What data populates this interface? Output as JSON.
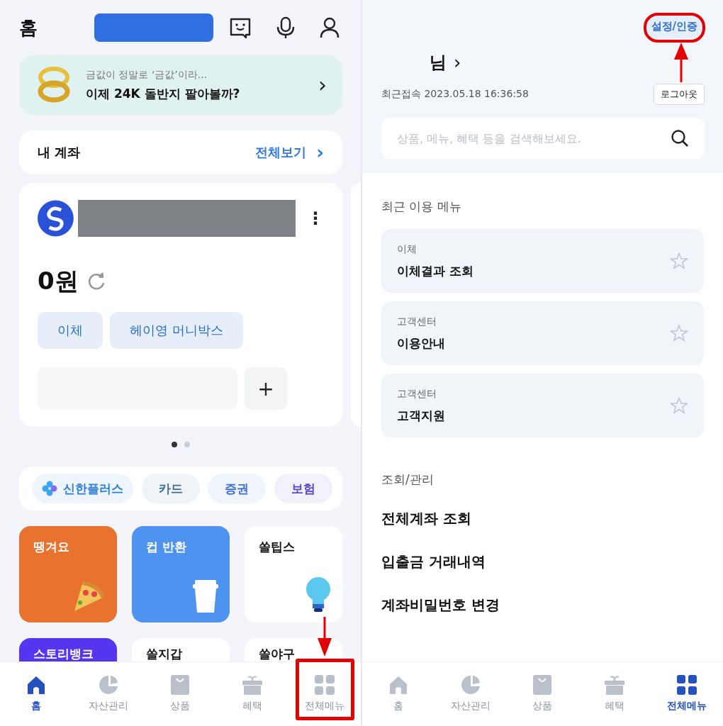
{
  "home_screen": {
    "title": "홈",
    "banner": {
      "caption": "금값이 정말로 ‘금값’이라...",
      "headline": "이제 24K 돌반지 팔아볼까?",
      "arrow": "›"
    },
    "my_accounts": {
      "title": "내 계좌",
      "link": "전체보기",
      "arrow": "›"
    },
    "account_card": {
      "balance": "0원",
      "actions": [
        "이체",
        "헤이영 머니박스"
      ],
      "add": "+",
      "menu": "⋮"
    },
    "pager": [
      {
        "selected": true
      },
      {
        "selected": false
      }
    ],
    "chips": [
      {
        "label": "신한플러스",
        "color": "#2f7fd8",
        "icon": true
      },
      {
        "label": "카드",
        "color": "#3c6f93",
        "icon": false
      },
      {
        "label": "증권",
        "color": "#3d6fd2",
        "icon": false
      },
      {
        "label": "보험",
        "color": "#5a46c8",
        "icon": false
      }
    ],
    "tiles": [
      {
        "label": "땡겨요",
        "color": "#e8722e",
        "kind": "pizza"
      },
      {
        "label": "컵 반환",
        "color": "#4f93f0",
        "kind": "cup"
      },
      {
        "label": "쏠팁스",
        "color": "#ffffff",
        "kind": "bulb"
      },
      {
        "label": "스토리뱅크",
        "color": "#5535f0",
        "kind": "plain"
      },
      {
        "label": "쏠지갑",
        "color": "#ffffff",
        "kind": "plain"
      },
      {
        "label": "쏠야구",
        "color": "#ffffff",
        "kind": "plain"
      }
    ],
    "nav": [
      {
        "label": "홈",
        "kind": "home",
        "selected": true
      },
      {
        "label": "자산관리",
        "kind": "pie",
        "selected": false
      },
      {
        "label": "상품",
        "kind": "bag",
        "selected": false
      },
      {
        "label": "혜택",
        "kind": "gift",
        "selected": false
      },
      {
        "label": "전체메뉴",
        "kind": "grid",
        "selected": false
      }
    ]
  },
  "menu_screen": {
    "settings": "설정/인증",
    "name_suffix": "님",
    "name_arrow": "›",
    "last_login": "최근접속 2023.05.18 16:36:58",
    "logout": "로그아웃",
    "search": {
      "placeholder": "상품, 메뉴, 혜택 등을 검색해보세요."
    },
    "recent_title": "최근 이용 메뉴",
    "recent": [
      {
        "category": "이체",
        "name": "이체결과 조회",
        "starred": false
      },
      {
        "category": "고객센터",
        "name": "이용안내",
        "starred": false
      },
      {
        "category": "고객센터",
        "name": "고객지원",
        "starred": false
      }
    ],
    "section_title": "조회/관리",
    "items": [
      "전체계좌 조회",
      "입출금 거래내역",
      "계좌비밀번호 변경"
    ],
    "nav": [
      {
        "label": "홈",
        "kind": "home",
        "selected": false
      },
      {
        "label": "자산관리",
        "kind": "pie",
        "selected": false
      },
      {
        "label": "상품",
        "kind": "bag",
        "selected": false
      },
      {
        "label": "혜택",
        "kind": "gift",
        "selected": false
      },
      {
        "label": "전체메뉴",
        "kind": "grid",
        "selected": true
      }
    ]
  }
}
